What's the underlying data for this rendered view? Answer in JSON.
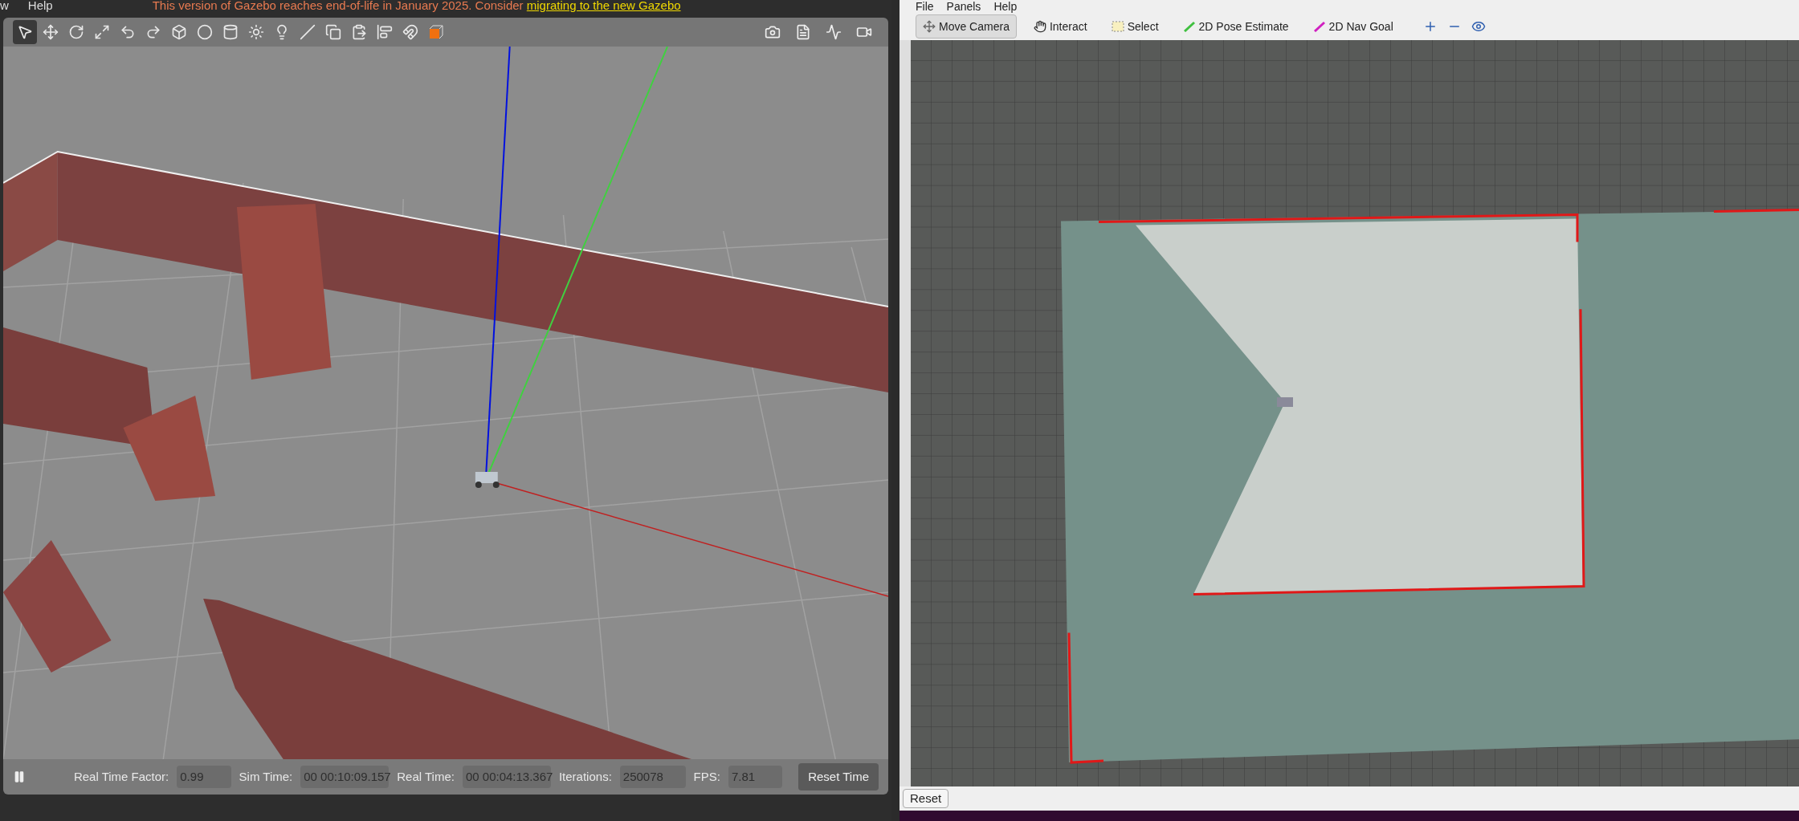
{
  "gazebo": {
    "menu": [
      "w",
      "Help"
    ],
    "notice": {
      "text": "This version of Gazebo reaches end-of-life in January 2025. Consider",
      "link": "migrating to the new Gazebo"
    },
    "toolbar": [
      {
        "kind": "select",
        "selected": true
      },
      {
        "kind": "translate",
        "selected": false
      },
      {
        "kind": "rotate",
        "selected": false
      },
      {
        "kind": "scale",
        "selected": false
      },
      {
        "kind": "undo",
        "selected": false
      },
      {
        "kind": "redo",
        "selected": false
      },
      {
        "kind": "box",
        "selected": false
      },
      {
        "kind": "sphere",
        "selected": false
      },
      {
        "kind": "cylinder",
        "selected": false
      },
      {
        "kind": "sun",
        "selected": false
      },
      {
        "kind": "spot",
        "selected": false
      },
      {
        "kind": "lines",
        "selected": false
      },
      {
        "kind": "copy",
        "selected": false
      },
      {
        "kind": "paste",
        "selected": false
      },
      {
        "kind": "align",
        "selected": false
      },
      {
        "kind": "magnet",
        "selected": false
      },
      {
        "kind": "view",
        "selected": false
      }
    ],
    "status": [
      {
        "label": "Real Time Factor:",
        "value": "0.99"
      },
      {
        "label": "Sim Time:",
        "value": "00 00:10:09.157"
      },
      {
        "label": "Real Time:",
        "value": "00 00:04:13.367"
      },
      {
        "label": "Iterations:",
        "value": "250078"
      },
      {
        "label": "FPS:",
        "value": "7.81"
      }
    ],
    "reset_button": "Reset Time"
  },
  "rviz": {
    "menu": [
      "File",
      "Panels",
      "Help"
    ],
    "tools": [
      {
        "kind": "camera",
        "label": "Move Camera",
        "selected": true
      },
      {
        "kind": "interact",
        "label": "Interact",
        "selected": false
      },
      {
        "kind": "select",
        "label": "Select",
        "selected": false
      },
      {
        "kind": "pose",
        "label": "2D Pose Estimate",
        "selected": false
      },
      {
        "kind": "goal",
        "label": "2D Nav Goal",
        "selected": false
      }
    ],
    "reset_button": "Reset"
  }
}
